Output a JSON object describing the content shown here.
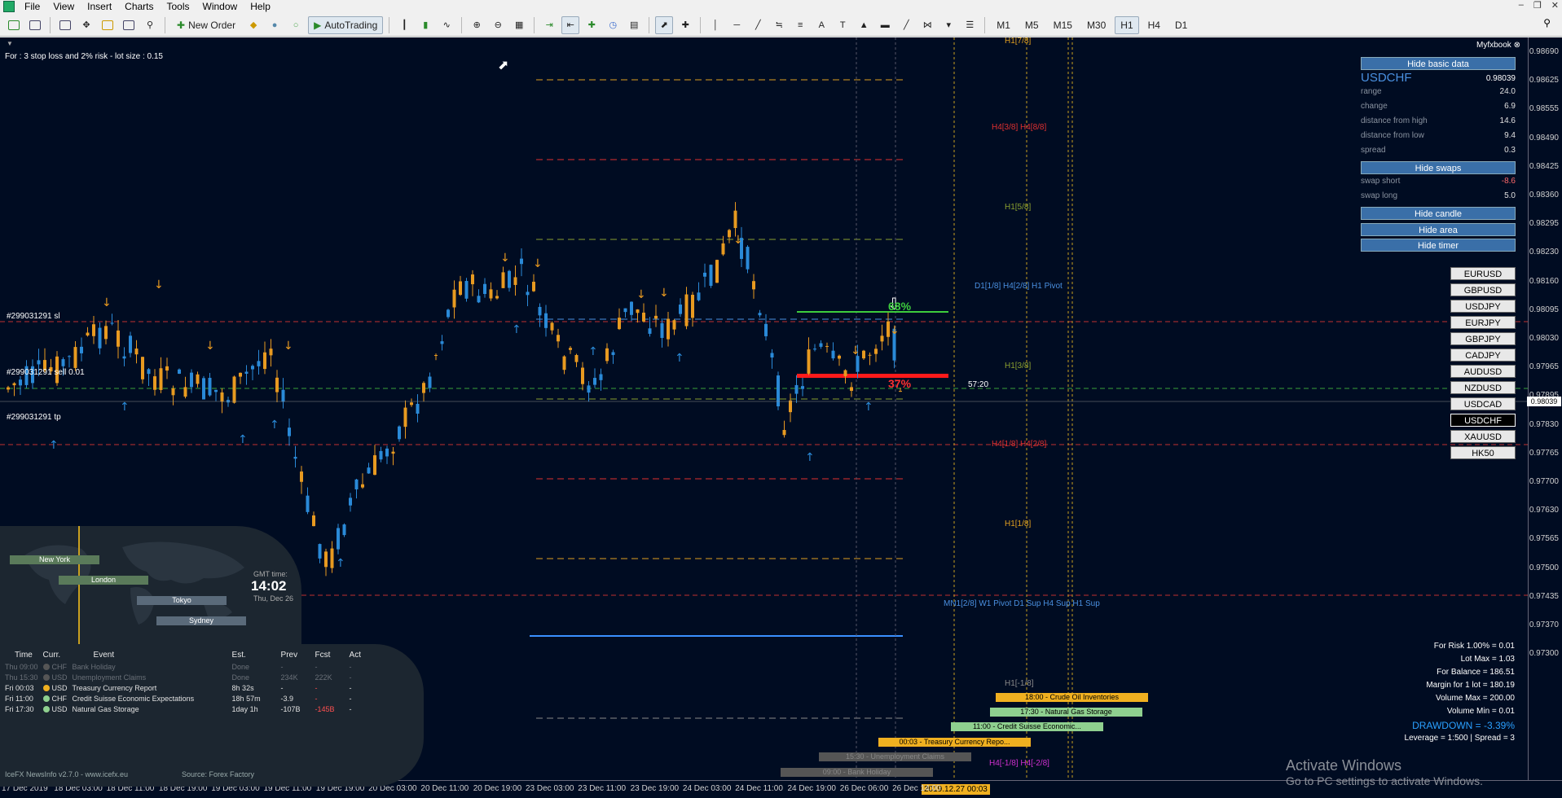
{
  "menu": {
    "items": [
      "File",
      "View",
      "Insert",
      "Charts",
      "Tools",
      "Window",
      "Help"
    ]
  },
  "toolbar": {
    "new_order": "New Order",
    "autotrading": "AutoTrading",
    "timeframes": [
      "M1",
      "M5",
      "M15",
      "M30",
      "H1",
      "H4",
      "D1"
    ],
    "active_timeframe": "H1"
  },
  "chart": {
    "info_text": "For : 3 stop loss and 2% risk - lot size : 0.15",
    "myfxbook": "Myfxbook",
    "price_ticks": [
      "0.98690",
      "0.98625",
      "0.98555",
      "0.98490",
      "0.98425",
      "0.98360",
      "0.98295",
      "0.98230",
      "0.98160",
      "0.98095",
      "0.98030",
      "0.97965",
      "0.97895",
      "0.97830",
      "0.97765",
      "0.97700",
      "0.97630",
      "0.97565",
      "0.97500",
      "0.97435",
      "0.97370",
      "0.97300"
    ],
    "current_price": "0.98039",
    "time_ticks": [
      "17 Dec 2019",
      "18 Dec 03:00",
      "18 Dec 11:00",
      "18 Dec 19:00",
      "19 Dec 03:00",
      "19 Dec 11:00",
      "19 Dec 19:00",
      "20 Dec 03:00",
      "20 Dec 11:00",
      "20 Dec 19:00",
      "23 Dec 03:00",
      "23 Dec 11:00",
      "23 Dec 19:00",
      "24 Dec 03:00",
      "24 Dec 11:00",
      "24 Dec 19:00",
      "26 Dec 06:00",
      "26 Dec 14:00"
    ],
    "time_highlight": "2019.12.27 00:03",
    "levels": {
      "h1_7_8": "H1[7/8]",
      "h4_3_8": "H4[3/8] H4[8/8]",
      "h1_5_8": "H1[5/8]",
      "d1_pivot": "D1[1/8] H4[2/8] H1 Pivot",
      "h1_3_8": "H1[3/8]",
      "h4_1_8": "H4[1/8] H4[2/8]",
      "h1_1_8": "H1[1/8]",
      "mn_label": "MN1[2/8] W1 Pivot D1 Sup H4 Sup H1 Sup",
      "h1_m1_8": "H1[-1/8]",
      "h4_m1_8": "H4[-1/8] H4[-2/8]"
    },
    "order_labels": [
      "#299031291 sl",
      "#299031291 sell 0.01",
      "#299031291 tp"
    ],
    "timer": "57:20",
    "pct_green": "68%",
    "pct_red": "37%",
    "news_bars": [
      {
        "label": "18:00 - Crude Oil Inventories",
        "color": "#f0b020"
      },
      {
        "label": "17:30 - Natural Gas Storage",
        "color": "#8fd08f"
      },
      {
        "label": "11:00 - Credit Suisse Economic...",
        "color": "#8fd08f"
      },
      {
        "label": "00:03 - Treasury Currency Repo...",
        "color": "#f0b020"
      },
      {
        "label": "15:30 - Unemployment Claims",
        "color": "#555"
      },
      {
        "label": "09:00 - Bank Holiday",
        "color": "#555"
      }
    ]
  },
  "panel": {
    "hide_basic": "Hide basic data",
    "symbol": "USDCHF",
    "symbol_price": "0.98039",
    "rows": [
      {
        "label": "range",
        "value": "24.0"
      },
      {
        "label": "change",
        "value": "6.9"
      },
      {
        "label": "distance from high",
        "value": "14.6"
      },
      {
        "label": "distance from low",
        "value": "9.4"
      },
      {
        "label": "spread",
        "value": "0.3"
      }
    ],
    "hide_swaps": "Hide swaps",
    "swap_short_label": "swap short",
    "swap_short": "-8.6",
    "swap_long_label": "swap long",
    "swap_long": "5.0",
    "hide_candle": "Hide candle",
    "hide_area": "Hide area",
    "hide_timer": "Hide timer",
    "symbols": [
      "EURUSD",
      "GBPUSD",
      "USDJPY",
      "EURJPY",
      "GBPJPY",
      "CADJPY",
      "AUDUSD",
      "NZDUSD",
      "USDCAD",
      "USDCHF",
      "XAUUSD",
      "HK50"
    ],
    "active_symbol": "USDCHF"
  },
  "risk": {
    "lines": [
      "For Risk 1.00% = 0.01",
      "Lot Max = 1.03",
      "For Balance = 186.51",
      "Margin for 1 lot = 180.19",
      "Volume Max = 200.00",
      "Volume Min = 0.01"
    ],
    "drawdown": "DRAWDOWN = -3.39%",
    "leverage": "Leverage = 1:500 | Spread = 3"
  },
  "clock": {
    "label": "GMT time:",
    "time": "14:02",
    "date": "Thu, Dec 26",
    "sessions": [
      "New York",
      "London",
      "Tokyo",
      "Sydney"
    ]
  },
  "news": {
    "headers": [
      "Time",
      "Curr.",
      "Event",
      "Est.",
      "Prev",
      "Fcst",
      "Act"
    ],
    "rows": [
      {
        "day": "Thu",
        "time": "09:00",
        "curr": "CHF",
        "event": "Bank Holiday",
        "est": "Done",
        "prev": "-",
        "fcst": "-",
        "act": "-",
        "dot": "#555",
        "dim": true
      },
      {
        "day": "Thu",
        "time": "15:30",
        "curr": "USD",
        "event": "Unemployment Claims",
        "est": "Done",
        "prev": "234K",
        "fcst": "222K",
        "act": "-",
        "dot": "#555",
        "dim": true
      },
      {
        "day": "Fri",
        "time": "00:03",
        "curr": "USD",
        "event": "Treasury Currency Report",
        "est": "8h 32s",
        "prev": "-",
        "fcst": "-",
        "act": "-",
        "dot": "#f0b020",
        "dim": false
      },
      {
        "day": "Fri",
        "time": "11:00",
        "curr": "CHF",
        "event": "Credit Suisse Economic Expectations",
        "est": "18h 57m",
        "prev": "-3.9",
        "fcst": "-",
        "act": "-",
        "dot": "#8fd08f",
        "dim": false
      },
      {
        "day": "Fri",
        "time": "17:30",
        "curr": "USD",
        "event": "Natural Gas Storage",
        "est": "1day 1h",
        "prev": "-107B",
        "fcst": "-145B",
        "act": "-",
        "dot": "#8fd08f",
        "dim": false
      }
    ],
    "footer_left": "IceFX NewsInfo v2.7.0 - www.icefx.eu",
    "footer_right": "Source: Forex Factory"
  },
  "watermark": {
    "title": "Activate Windows",
    "subtitle": "Go to PC settings to activate Windows."
  }
}
